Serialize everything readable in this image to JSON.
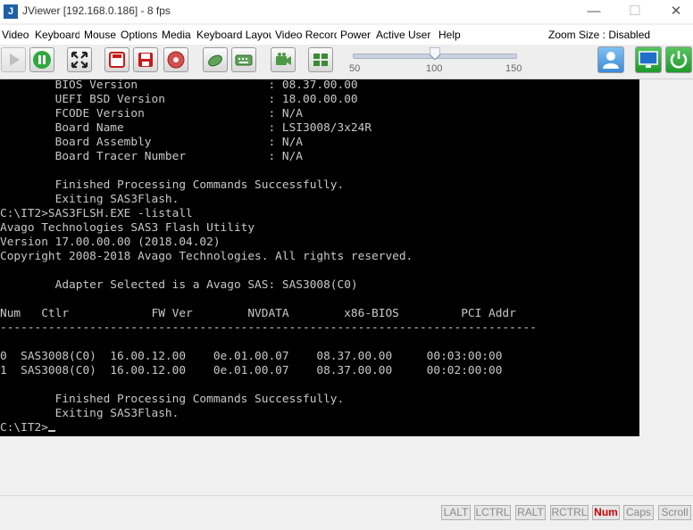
{
  "window": {
    "title": "JViewer [192.168.0.186] - 8 fps",
    "app_icon": "J"
  },
  "window_controls": {
    "minimize": "—",
    "maximize": "☐",
    "close": "✕"
  },
  "menu": {
    "items": [
      "Video",
      "Keyboard",
      "Mouse",
      "Options",
      "Media",
      "Keyboard Layout",
      "Video Record",
      "Power",
      "Active User",
      "Help"
    ],
    "zoom_label": "Zoom Size : Disabled"
  },
  "toolbar": {
    "slider": {
      "ticks": [
        "50",
        "100",
        "150"
      ],
      "min": 50,
      "max": 150,
      "value": 100
    },
    "colors": {
      "accent_blue": "#3b8ad8",
      "accent_green": "#25a33a",
      "record_red": "#c81818"
    }
  },
  "terminal": {
    "lines": [
      "        BIOS Version                   : 08.37.00.00",
      "        UEFI BSD Version               : 18.00.00.00",
      "        FCODE Version                  : N/A",
      "        Board Name                     : LSI3008/3x24R",
      "        Board Assembly                 : N/A",
      "        Board Tracer Number            : N/A",
      "",
      "        Finished Processing Commands Successfully.",
      "        Exiting SAS3Flash.",
      "C:\\IT2>SAS3FLSH.EXE -listall",
      "Avago Technologies SAS3 Flash Utility",
      "Version 17.00.00.00 (2018.04.02)",
      "Copyright 2008-2018 Avago Technologies. All rights reserved.",
      "",
      "        Adapter Selected is a Avago SAS: SAS3008(C0)",
      "",
      "Num   Ctlr            FW Ver        NVDATA        x86-BIOS         PCI Addr",
      "------------------------------------------------------------------------------",
      "",
      "0  SAS3008(C0)  16.00.12.00    0e.01.00.07    08.37.00.00     00:03:00:00",
      "1  SAS3008(C0)  16.00.12.00    0e.01.00.07    08.37.00.00     00:02:00:00",
      "",
      "        Finished Processing Commands Successfully.",
      "        Exiting SAS3Flash.",
      "C:\\IT2>"
    ]
  },
  "status_keys": [
    {
      "label": "LALT",
      "active": false
    },
    {
      "label": "LCTRL",
      "active": false
    },
    {
      "label": "RALT",
      "active": false
    },
    {
      "label": "RCTRL",
      "active": false
    },
    {
      "label": "Num",
      "active": true
    },
    {
      "label": "Caps",
      "active": false
    },
    {
      "label": "Scroll",
      "active": false
    }
  ]
}
